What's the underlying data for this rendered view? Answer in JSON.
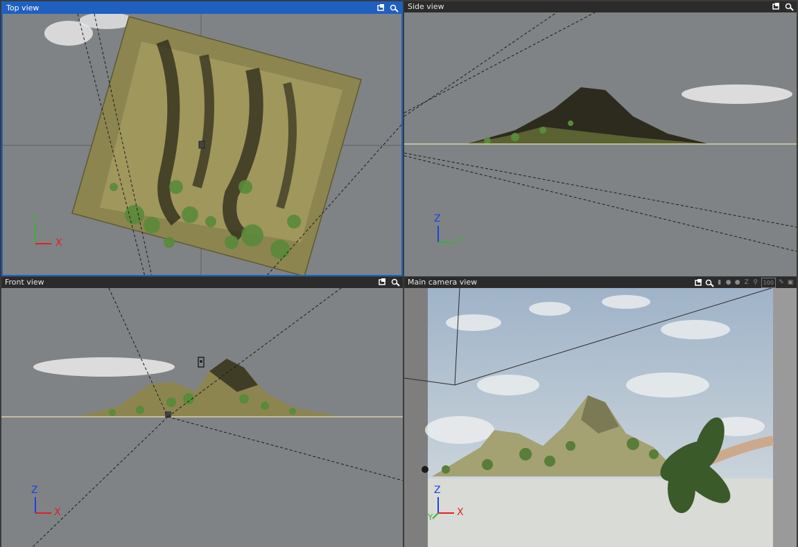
{
  "panes": {
    "top": {
      "title": "Top view",
      "axis_v": "Y",
      "axis_h": "X"
    },
    "side": {
      "title": "Side view",
      "axis_v": "Z",
      "axis_h": "Y"
    },
    "front": {
      "title": "Front view",
      "axis_v": "Z",
      "axis_h": "X"
    },
    "camera": {
      "title": "Main camera view",
      "axis_v": "Z",
      "axis_h": "X",
      "axis_d": "Y",
      "zoom_label": "100"
    }
  },
  "icons": {
    "maximize": "maximize-view-icon",
    "camera_options": "camera-options-icon"
  },
  "colors": {
    "active_border": "#1c63c7",
    "viewport_bg": "#7f8385",
    "ground": "#d8d0b0",
    "terrain": "#8c8550",
    "vegetation": "#5a8a3a"
  }
}
